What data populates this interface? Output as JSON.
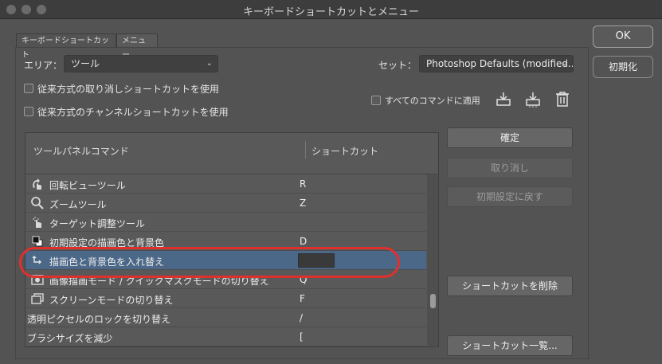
{
  "window": {
    "title": "キーボードショートカットとメニュー"
  },
  "dialog_buttons": {
    "ok": "OK",
    "reset": "初期化"
  },
  "tabs": [
    {
      "label": "キーボードショートカット"
    },
    {
      "label": "メニュー"
    }
  ],
  "area": {
    "label": "エリア：",
    "value": "ツール"
  },
  "set": {
    "label": "セット：",
    "value": "Photoshop Defaults (modified..."
  },
  "options": {
    "legacy_undo": "従来方式の取り消しショートカットを使用",
    "legacy_channel": "従来方式のチャンネルショートカットを使用",
    "apply_all": "すべてのコマンドに適用"
  },
  "table": {
    "col_command": "ツールパネルコマンド",
    "col_shortcut": "ショートカット",
    "rows": [
      {
        "name": "回転ビューツール",
        "key": "R",
        "icon": "rotate-view-icon"
      },
      {
        "name": "ズームツール",
        "key": "Z",
        "icon": "zoom-icon"
      },
      {
        "name": "ターゲット調整ツール",
        "key": "",
        "icon": "targeted-adjust-icon"
      },
      {
        "name": "初期設定の描画色と背景色",
        "key": "D",
        "icon": "default-colors-icon"
      },
      {
        "name": "描画色と背景色を入れ替え",
        "key": "",
        "icon": "swap-colors-icon"
      },
      {
        "name": "画像描画モード / クイックマスクモードの切り替え",
        "key": "Q",
        "icon": "quick-mask-icon"
      },
      {
        "name": "スクリーンモードの切り替え",
        "key": "F",
        "icon": "screen-mode-icon"
      },
      {
        "name": "透明ピクセルのロックを切り替え",
        "key": "/",
        "icon": ""
      },
      {
        "name": "ブラシサイズを減少",
        "key": "[",
        "icon": ""
      }
    ]
  },
  "side_buttons": {
    "accept": "確定",
    "undo": "取り消し",
    "use_default": "初期設定に戻す",
    "delete_shortcut": "ショートカットを削除",
    "summarize": "ショートカット一覧..."
  }
}
